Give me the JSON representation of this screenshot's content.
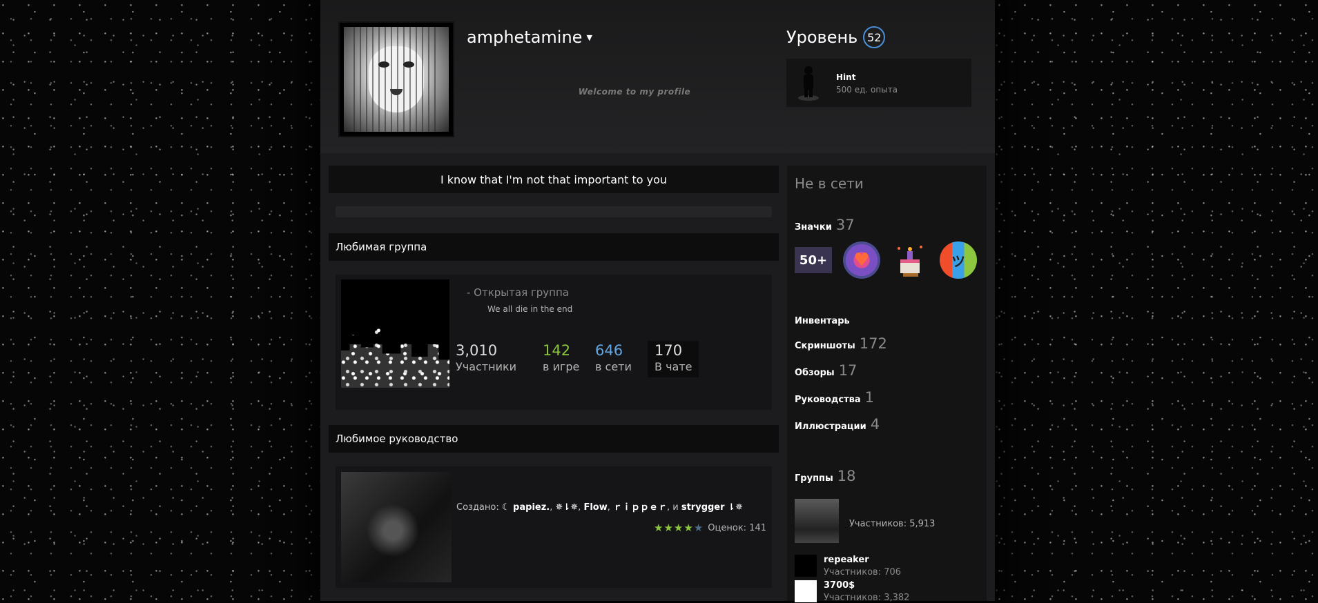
{
  "profile": {
    "persona_name": "amphetamine",
    "summary": "Welcome to my profile",
    "level_label": "Уровень",
    "level_value": "52",
    "favorite_badge": {
      "name": "Hint",
      "xp": "500 ед. опыта"
    }
  },
  "main": {
    "quote": "I know that I'm not that important to you",
    "favorite_group": {
      "header": "Любимая группа",
      "type": "- Открытая группа",
      "description": "We all die in the end",
      "stats": [
        {
          "value": "3,010",
          "label": "Участники",
          "color": "#ffffff"
        },
        {
          "value": "142",
          "label": "в игре",
          "color": "#8bc53f"
        },
        {
          "value": "646",
          "label": "в сети",
          "color": "#62a7e3"
        },
        {
          "value": "170",
          "label": "В чате",
          "color": "#ffffff"
        }
      ]
    },
    "favorite_guide": {
      "header": "Любимое руководство",
      "created_by_label": "Создано:",
      "authors": [
        "☾ papiez.",
        "✵⇂✵",
        "Flow",
        "ｒｉｐｐｅｒ",
        "strygger ⇂✵"
      ],
      "and_word": "и",
      "rating_label": "Оценок: 141",
      "stars_filled": 4,
      "stars_total": 5
    }
  },
  "sidebar": {
    "status": "Не в сети",
    "badges": {
      "label": "Значки",
      "count": "37",
      "items": [
        "50+",
        "heart-badge-icon",
        "cake-badge-icon",
        "face-badge-icon"
      ]
    },
    "inventory": "Инвентарь",
    "screenshots": {
      "label": "Скриншоты",
      "count": "172"
    },
    "reviews": {
      "label": "Обзоры",
      "count": "17"
    },
    "guides": {
      "label": "Руководства",
      "count": "1"
    },
    "artwork": {
      "label": "Иллюстрации",
      "count": "4"
    },
    "groups": {
      "label": "Группы",
      "count": "18",
      "primary_members": "Участников: 5,913",
      "items": [
        {
          "name": "repeaker",
          "members": "Участников: 706"
        },
        {
          "name": "3700$",
          "members": "Участников: 3,382"
        }
      ]
    }
  }
}
